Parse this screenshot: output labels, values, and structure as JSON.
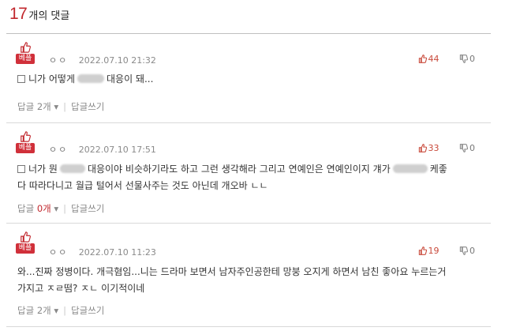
{
  "header": {
    "count": "17",
    "label": "개의 댓글"
  },
  "comments": [
    {
      "badge": "베플",
      "nickname": "ㅇㅇ",
      "date": "2022.07.10 21:32",
      "up": "44",
      "down": "0",
      "text_parts": [
        "니가 어떻게",
        "대응이 돼..."
      ],
      "reply_label": "답글",
      "reply_count": "2개",
      "reply_arrow": "▾",
      "write_reply": "답글쓰기"
    },
    {
      "badge": "베플",
      "nickname": "ㅇㅇ",
      "date": "2022.07.10 17:51",
      "up": "33",
      "down": "0",
      "line1_parts": [
        "너가 뭔",
        "대응이야 비슷하기라도 하고 그런 생각해라 그리고 연예인은 연예인이지 걔가",
        "케좋"
      ],
      "line2": "다 따라다니고 월급 털어서 선물사주는 것도 아닌데 개오바 ㄴㄴ",
      "reply_label": "답글",
      "reply_count": "0개",
      "reply_arrow": "▾",
      "write_reply": "답글쓰기"
    },
    {
      "badge": "베플",
      "nickname": "ㅇㅇ",
      "date": "2022.07.10 11:23",
      "up": "19",
      "down": "0",
      "line1": "와...진짜 정병이다. 개극혐임...니는 드라마 보면서 남자주인공한테 망붕 오지게 하면서 남친 좋아요 누르는거",
      "line2": "가지고 ㅈㄹ떰? ㅈㄴ 이기적이네",
      "reply_label": "답글",
      "reply_count": "2개",
      "reply_arrow": "▾",
      "write_reply": "답글쓰기"
    }
  ],
  "colors": {
    "accent": "#c1272d",
    "badge": "#d0303a",
    "muted": "#8a8a8a"
  },
  "icons": {
    "badge": "thumbs-up-icon",
    "up": "thumbs-up-icon",
    "down": "thumbs-down-icon",
    "text_marker": "square-icon"
  }
}
